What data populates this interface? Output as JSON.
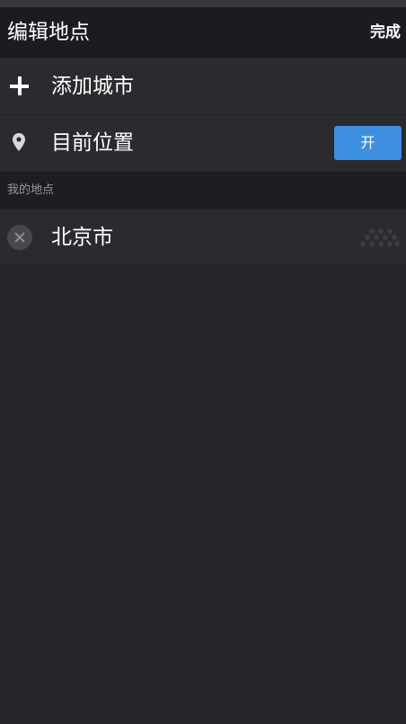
{
  "header": {
    "title": "编辑地点",
    "done_label": "完成"
  },
  "add_city": {
    "label": "添加城市",
    "icon": "plus-icon"
  },
  "current_location": {
    "label": "目前位置",
    "icon": "location-pin-icon",
    "toggle_label": "开"
  },
  "section": {
    "label": "我的地点"
  },
  "locations": [
    {
      "name": "北京市",
      "delete_icon": "close-icon",
      "handle_icon": "drag-handle-icon"
    }
  ],
  "colors": {
    "background": "#27262a",
    "header": "#1c1b1f",
    "row": "#2b2a2e",
    "accent": "#3b8fde",
    "section_text": "#9a999d"
  }
}
